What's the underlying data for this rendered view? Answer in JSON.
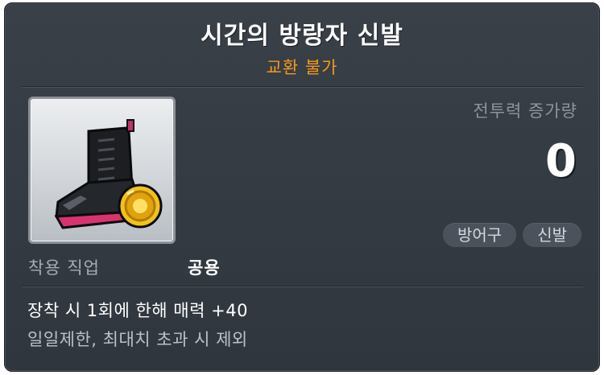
{
  "item": {
    "name": "시간의 방랑자 신발",
    "trade_status": "교환 불가",
    "icon": "boots-with-coin-icon"
  },
  "power": {
    "label": "전투력 증가량",
    "value": "0"
  },
  "tags": [
    "방어구",
    "신발"
  ],
  "job": {
    "label": "착용 직업",
    "value": "공용"
  },
  "description": {
    "line1": "장착 시 1회에 한해 매력 +40",
    "line2": "일일제한, 최대치 초과 시 제외"
  },
  "colors": {
    "background": "#353b43",
    "title": "#ffffff",
    "trade_status": "#f3981f",
    "muted": "#8e949b",
    "tag_bg": "#4b525b"
  }
}
